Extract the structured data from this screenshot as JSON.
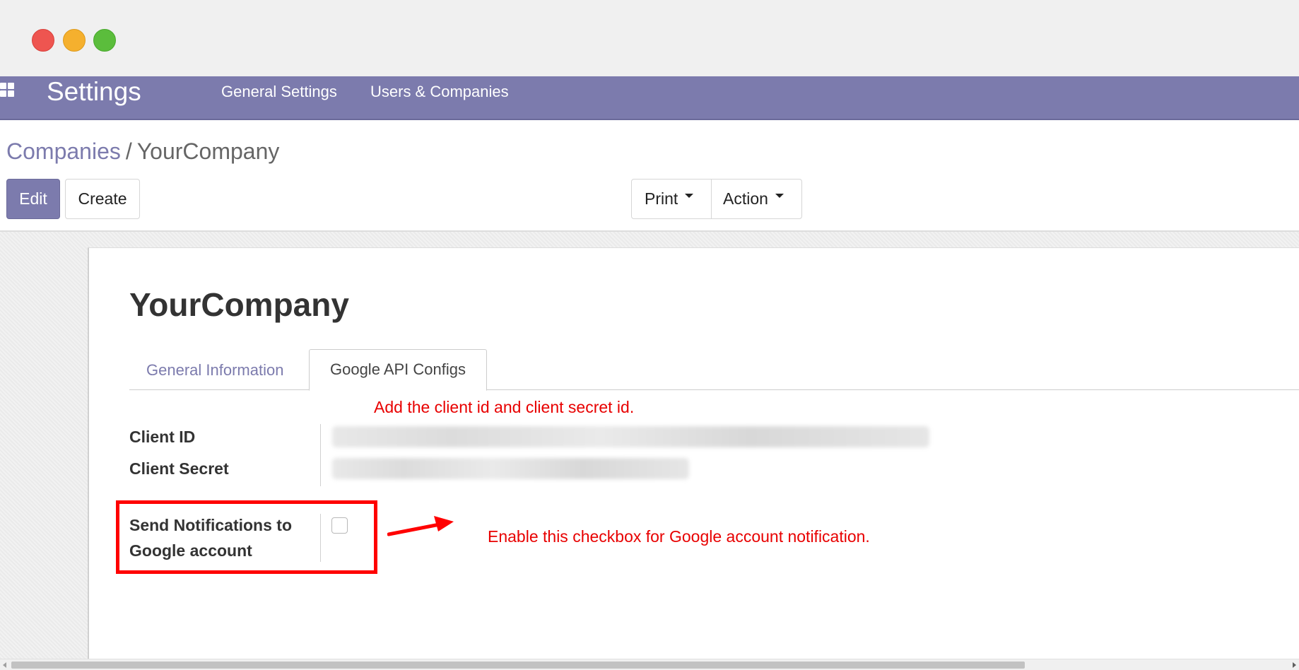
{
  "navbar": {
    "app_title": "Settings",
    "menu": [
      "General Settings",
      "Users & Companies"
    ]
  },
  "breadcrumb": {
    "parent": "Companies",
    "separator": "/",
    "current": "YourCompany"
  },
  "toolbar": {
    "edit_label": "Edit",
    "create_label": "Create",
    "print_label": "Print",
    "action_label": "Action"
  },
  "record": {
    "title": "YourCompany",
    "tabs": [
      "General Information",
      "Google API Configs"
    ],
    "fields": {
      "client_id_label": "Client ID",
      "client_secret_label": "Client Secret",
      "send_notifications_label_line1": "Send Notifications to",
      "send_notifications_label_line2": "Google account"
    }
  },
  "annotations": {
    "client_note": "Add the client id and client secret id.",
    "checkbox_note": "Enable this checkbox for Google account notification."
  },
  "colors": {
    "brand": "#7c7bad",
    "annotation": "#e80000"
  }
}
